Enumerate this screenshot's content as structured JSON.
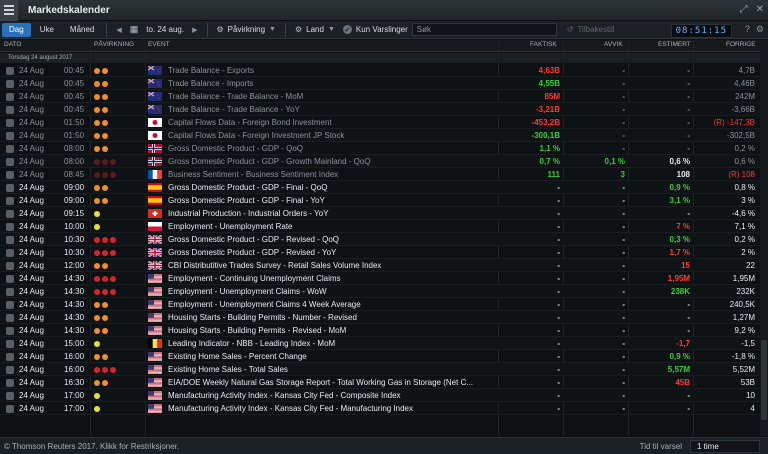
{
  "app": {
    "title": "Markedskalender",
    "clock": "08:51:15"
  },
  "toolbar": {
    "tabs": [
      "Dag",
      "Uke",
      "Måned"
    ],
    "date_label": "to. 24 aug.",
    "impact_label": "Påvirkning",
    "country_label": "Land",
    "alerts_label": "Kun Varslinger",
    "search_placeholder": "Søk",
    "back_label": "Tilbakestill"
  },
  "columns": {
    "date": "DATO",
    "impact": "PÅVIRKNING",
    "event": "EVENT",
    "actual": "FAKTISK",
    "deviation": "AVVIK",
    "estimate": "ESTIMERT",
    "previous": "FORRIGE"
  },
  "group_label": "Torsdag 24 august 2017",
  "rows": [
    {
      "date": "24 Aug",
      "time": "00:45",
      "impact": [
        "orange",
        "orange"
      ],
      "flag": "nz",
      "event": "Trade Balance - Exports",
      "actual": "4,63B",
      "actual_color": "neg",
      "dev": "-",
      "est": "-",
      "prev": "4,7B",
      "state": "past"
    },
    {
      "date": "24 Aug",
      "time": "00:45",
      "impact": [
        "orange",
        "orange"
      ],
      "flag": "nz",
      "event": "Trade Balance - Imports",
      "actual": "4,55B",
      "actual_color": "pos",
      "dev": "-",
      "est": "-",
      "prev": "4,46B",
      "state": "past"
    },
    {
      "date": "24 Aug",
      "time": "00:45",
      "impact": [
        "orange",
        "orange"
      ],
      "flag": "nz",
      "event": "Trade Balance - Trade Balance - MoM",
      "actual": "85M",
      "actual_color": "neg",
      "dev": "-",
      "est": "-",
      "prev": "242M",
      "state": "past"
    },
    {
      "date": "24 Aug",
      "time": "00:45",
      "impact": [
        "orange",
        "orange"
      ],
      "flag": "nz",
      "event": "Trade Balance - Trade Balance - YoY",
      "actual": "-3,21B",
      "actual_color": "neg",
      "dev": "-",
      "est": "-",
      "prev": "-3,66B",
      "state": "past"
    },
    {
      "date": "24 Aug",
      "time": "01:50",
      "impact": [
        "orange",
        "orange"
      ],
      "flag": "jp",
      "event": "Capital Flows Data - Foreign Bond Investment",
      "actual": "-453,2B",
      "actual_color": "neg",
      "dev": "-",
      "est": "-",
      "prev": "(R) -147,3B",
      "prev_color": "neg",
      "state": "past"
    },
    {
      "date": "24 Aug",
      "time": "01:50",
      "impact": [
        "orange",
        "orange"
      ],
      "flag": "jp",
      "event": "Capital Flows Data - Foreign Investment JP Stock",
      "actual": "-300,1B",
      "actual_color": "pos",
      "dev": "-",
      "est": "-",
      "prev": "-302,5B",
      "state": "past"
    },
    {
      "date": "24 Aug",
      "time": "08:00",
      "impact": [
        "orange",
        "orange"
      ],
      "flag": "no",
      "event": "Gross Domestic Product - GDP - QoQ",
      "actual": "1,1 %",
      "actual_color": "pos",
      "dev": "-",
      "est": "-",
      "prev": "0,2 %",
      "state": "past"
    },
    {
      "date": "24 Aug",
      "time": "08:00",
      "impact": [
        "darkred",
        "darkred",
        "darkred"
      ],
      "flag": "no",
      "event": "Gross Domestic Product - GDP - Growth Mainland - QoQ",
      "actual": "0,7 %",
      "actual_color": "pos",
      "dev": "0,1 %",
      "dev_color": "pos",
      "est": "0,6 %",
      "est_color": "neutral",
      "prev": "0,6 %",
      "state": "past"
    },
    {
      "date": "24 Aug",
      "time": "08:45",
      "impact": [
        "darkred",
        "darkred",
        "darkred"
      ],
      "flag": "fr",
      "event": "Business Sentiment - Business Sentiment Index",
      "actual": "111",
      "actual_color": "pos",
      "dev": "3",
      "dev_color": "pos",
      "est": "108",
      "est_color": "neutral",
      "prev": "(R) 108",
      "prev_color": "neg",
      "state": "past"
    },
    {
      "date": "24 Aug",
      "time": "09:00",
      "impact": [
        "orange",
        "orange"
      ],
      "flag": "es",
      "event": "Gross Domestic Product - GDP - Final - QoQ",
      "actual": "-",
      "dev": "-",
      "est": "0,9 %",
      "est_color": "pos",
      "prev": "0,8 %",
      "state": "current"
    },
    {
      "date": "24 Aug",
      "time": "09:00",
      "impact": [
        "orange",
        "orange"
      ],
      "flag": "es",
      "event": "Gross Domestic Product - GDP - Final - YoY",
      "actual": "-",
      "dev": "-",
      "est": "3,1 %",
      "est_color": "pos",
      "prev": "3 %",
      "state": "current"
    },
    {
      "date": "24 Aug",
      "time": "09:15",
      "impact": [
        "yellow"
      ],
      "flag": "ch",
      "event": "Industrial Production - Industrial Orders - YoY",
      "actual": "-",
      "dev": "-",
      "est": "-",
      "prev": "-4,6 %",
      "state": "current"
    },
    {
      "date": "24 Aug",
      "time": "10:00",
      "impact": [
        "yellow"
      ],
      "flag": "pl",
      "event": "Employment - Unemployment Rate",
      "actual": "-",
      "dev": "-",
      "est": "7 %",
      "est_color": "neg",
      "prev": "7,1 %",
      "state": "current"
    },
    {
      "date": "24 Aug",
      "time": "10:30",
      "impact": [
        "red",
        "red",
        "red"
      ],
      "flag": "gb",
      "event": "Gross Domestic Product - GDP - Revised - QoQ",
      "actual": "-",
      "dev": "-",
      "est": "0,3 %",
      "est_color": "pos",
      "prev": "0,2 %",
      "state": "current"
    },
    {
      "date": "24 Aug",
      "time": "10:30",
      "impact": [
        "red",
        "red",
        "red"
      ],
      "flag": "gb",
      "event": "Gross Domestic Product - GDP - Revised - YoY",
      "actual": "-",
      "dev": "-",
      "est": "1,7 %",
      "est_color": "neg",
      "prev": "2 %",
      "state": "current"
    },
    {
      "date": "24 Aug",
      "time": "12:00",
      "impact": [
        "orange",
        "orange"
      ],
      "flag": "gb",
      "event": "CBI Distributitive Trades Survey - Retail Sales Volume Index",
      "actual": "-",
      "dev": "-",
      "est": "15",
      "est_color": "neg",
      "prev": "22",
      "state": "current"
    },
    {
      "date": "24 Aug",
      "time": "14:30",
      "impact": [
        "red",
        "red",
        "red"
      ],
      "flag": "us",
      "event": "Employment - Continuing Unemployment Claims",
      "actual": "-",
      "dev": "-",
      "est": "1,95M",
      "est_color": "neg",
      "prev": "1,95M",
      "state": "current"
    },
    {
      "date": "24 Aug",
      "time": "14:30",
      "impact": [
        "red",
        "red",
        "red"
      ],
      "flag": "us",
      "event": "Employment - Unemployment Claims - WoW",
      "actual": "-",
      "dev": "-",
      "est": "238K",
      "est_color": "pos",
      "prev": "232K",
      "state": "current"
    },
    {
      "date": "24 Aug",
      "time": "14:30",
      "impact": [
        "orange",
        "orange"
      ],
      "flag": "us",
      "event": "Employment - Unemployment Claims 4 Week Average",
      "actual": "-",
      "dev": "-",
      "est": "-",
      "prev": "240,5K",
      "state": "current"
    },
    {
      "date": "24 Aug",
      "time": "14:30",
      "impact": [
        "orange",
        "orange"
      ],
      "flag": "us",
      "event": "Housing Starts - Building Permits - Number - Revised",
      "actual": "-",
      "dev": "-",
      "est": "-",
      "prev": "1,27M",
      "state": "current"
    },
    {
      "date": "24 Aug",
      "time": "14:30",
      "impact": [
        "orange",
        "orange"
      ],
      "flag": "us",
      "event": "Housing Starts - Building Permits - Revised - MoM",
      "actual": "-",
      "dev": "-",
      "est": "-",
      "prev": "9,2 %",
      "state": "current"
    },
    {
      "date": "24 Aug",
      "time": "15:00",
      "impact": [
        "yellow"
      ],
      "flag": "be",
      "event": "Leading Indicator - NBB - Leading Index - MoM",
      "actual": "-",
      "dev": "-",
      "est": "-1,7",
      "est_color": "neg",
      "prev": "-1,5",
      "state": "current"
    },
    {
      "date": "24 Aug",
      "time": "16:00",
      "impact": [
        "orange",
        "orange"
      ],
      "flag": "us",
      "event": "Existing Home Sales - Percent Change",
      "actual": "-",
      "dev": "-",
      "est": "0,9 %",
      "est_color": "pos",
      "prev": "-1,8 %",
      "state": "current"
    },
    {
      "date": "24 Aug",
      "time": "16:00",
      "impact": [
        "red",
        "red",
        "red"
      ],
      "flag": "us",
      "event": "Existing Home Sales - Total Sales",
      "actual": "-",
      "dev": "-",
      "est": "5,57M",
      "est_color": "pos",
      "prev": "5,52M",
      "state": "current"
    },
    {
      "date": "24 Aug",
      "time": "16:30",
      "impact": [
        "orange",
        "orange"
      ],
      "flag": "us",
      "event": "EIA/DOE Weekly Natural Gas Storage Report - Total Working Gas in Storage (Net C...",
      "actual": "-",
      "dev": "-",
      "est": "45B",
      "est_color": "neg",
      "prev": "53B",
      "state": "current"
    },
    {
      "date": "24 Aug",
      "time": "17:00",
      "impact": [
        "yellow"
      ],
      "flag": "us",
      "event": "Manufacturing Activity Index - Kansas City Fed - Composite Index",
      "actual": "-",
      "dev": "-",
      "est": "-",
      "prev": "10",
      "state": "current"
    },
    {
      "date": "24 Aug",
      "time": "17:00",
      "impact": [
        "yellow"
      ],
      "flag": "us",
      "event": "Manufacturing Activity Index - Kansas City Fed - Manufacturing Index",
      "actual": "-",
      "dev": "-",
      "est": "-",
      "prev": "4",
      "state": "current"
    }
  ],
  "footer": {
    "copyright": "© Thomson Reuters 2017. Klikk for Restriksjoner.",
    "until_label": "Tid til varsel",
    "until_value": "1 time"
  },
  "colors": {
    "accent": "#2a72b8",
    "negative": "#ff3b30",
    "positive": "#35d135"
  }
}
